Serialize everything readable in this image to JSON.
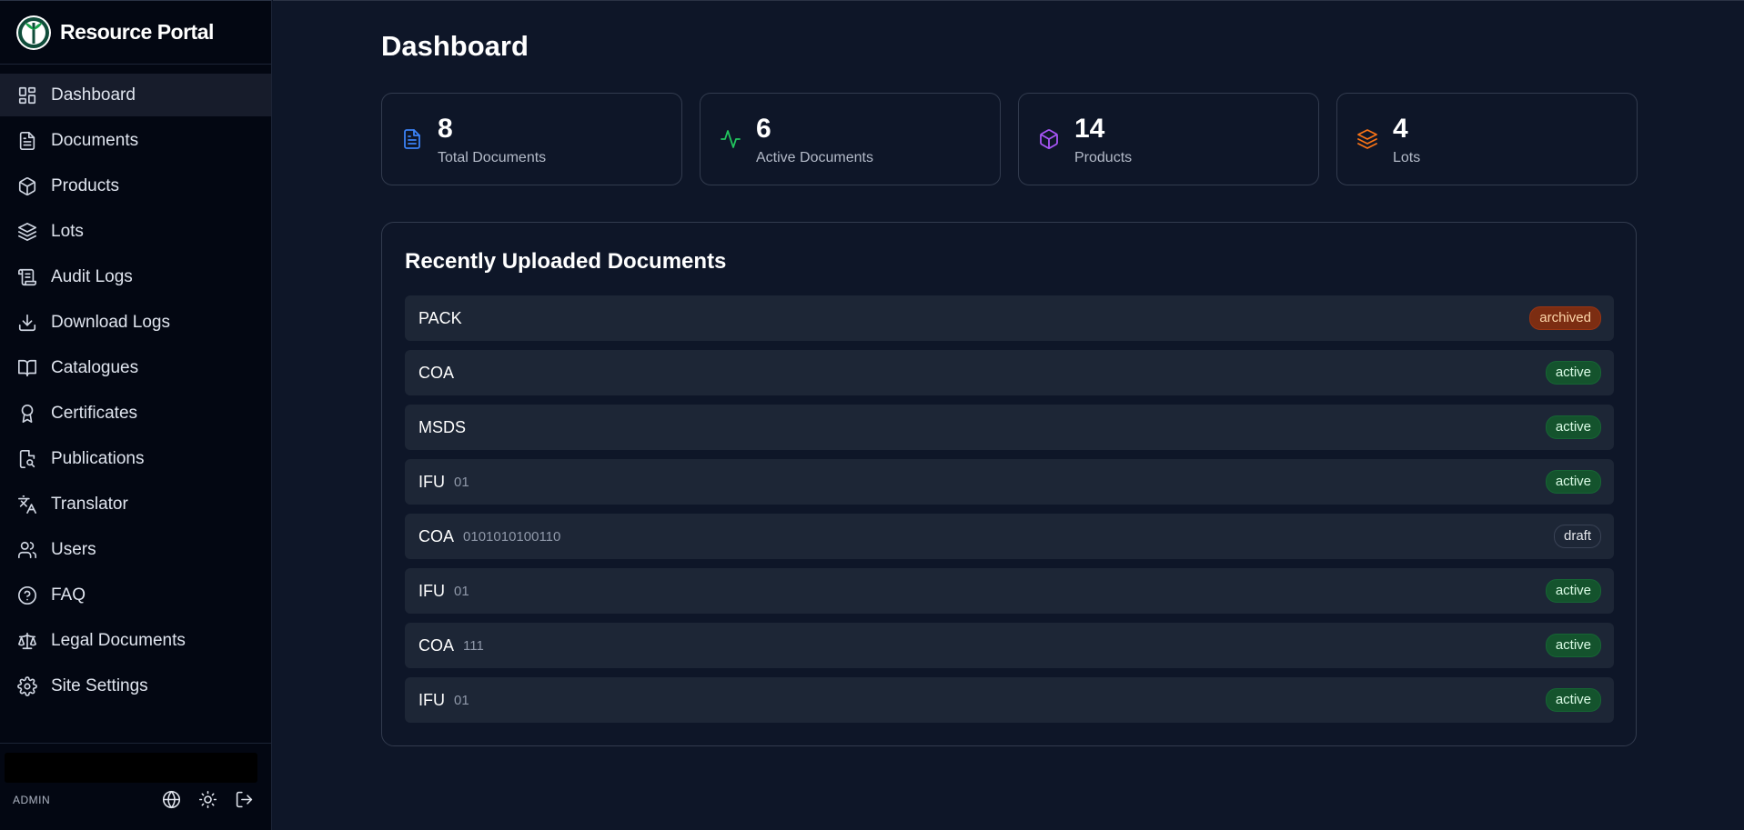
{
  "brand": {
    "name": "Resource Portal"
  },
  "sidebar": {
    "items": [
      {
        "label": "Dashboard",
        "icon": "dashboard-icon",
        "active": true
      },
      {
        "label": "Documents",
        "icon": "document-icon"
      },
      {
        "label": "Products",
        "icon": "box-icon"
      },
      {
        "label": "Lots",
        "icon": "layers-icon"
      },
      {
        "label": "Audit Logs",
        "icon": "scroll-icon"
      },
      {
        "label": "Download Logs",
        "icon": "download-icon"
      },
      {
        "label": "Catalogues",
        "icon": "book-open-icon"
      },
      {
        "label": "Certificates",
        "icon": "award-icon"
      },
      {
        "label": "Publications",
        "icon": "file-search-icon"
      },
      {
        "label": "Translator",
        "icon": "languages-icon"
      },
      {
        "label": "Users",
        "icon": "users-icon"
      },
      {
        "label": "FAQ",
        "icon": "help-circle-icon"
      },
      {
        "label": "Legal Documents",
        "icon": "scale-icon"
      },
      {
        "label": "Site Settings",
        "icon": "gear-icon"
      }
    ],
    "footer": {
      "role": "ADMIN"
    }
  },
  "page": {
    "title": "Dashboard"
  },
  "stats": [
    {
      "value": "8",
      "label": "Total Documents",
      "icon": "file-text-icon",
      "color": "#3b82f6"
    },
    {
      "value": "6",
      "label": "Active Documents",
      "icon": "activity-icon",
      "color": "#22c55e"
    },
    {
      "value": "14",
      "label": "Products",
      "icon": "box-icon",
      "color": "#a855f7"
    },
    {
      "value": "4",
      "label": "Lots",
      "icon": "layers-icon",
      "color": "#f97316"
    }
  ],
  "recent": {
    "title": "Recently Uploaded Documents",
    "rows": [
      {
        "type": "PACK",
        "code": "",
        "status": "archived"
      },
      {
        "type": "COA",
        "code": "",
        "status": "active"
      },
      {
        "type": "MSDS",
        "code": "",
        "status": "active"
      },
      {
        "type": "IFU",
        "code": "01",
        "status": "active"
      },
      {
        "type": "COA",
        "code": "0101010100110",
        "status": "draft"
      },
      {
        "type": "IFU",
        "code": "01",
        "status": "active"
      },
      {
        "type": "COA",
        "code": "111",
        "status": "active"
      },
      {
        "type": "IFU",
        "code": "01",
        "status": "active"
      }
    ]
  },
  "colors": {
    "sidebar_bg": "#030712",
    "main_bg": "#0e1628",
    "row_bg": "#1d2636",
    "archived": "#7c2d12",
    "active": "#14532d"
  }
}
